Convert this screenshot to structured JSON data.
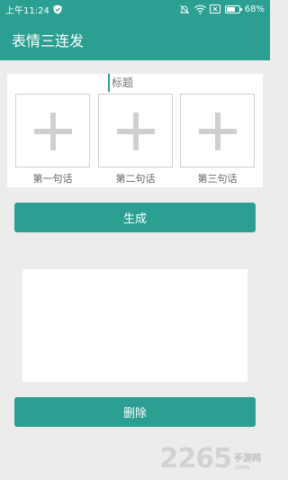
{
  "status_bar": {
    "time": "上午11:24",
    "battery_text": "68%",
    "battery_level": 0.68,
    "icons": [
      "shield-icon",
      "mute-bell-icon",
      "wifi-icon",
      "sim-x-icon",
      "battery-icon"
    ]
  },
  "app_bar": {
    "title": "表情三连发"
  },
  "form": {
    "title_placeholder": "标题",
    "slots": [
      {
        "label": "第一句话",
        "icon": "plus-icon"
      },
      {
        "label": "第二句话",
        "icon": "plus-icon"
      },
      {
        "label": "第三句话",
        "icon": "plus-icon"
      }
    ]
  },
  "buttons": {
    "generate": "生成",
    "delete": "删除"
  },
  "watermark": {
    "number": "2265",
    "chinese": "手游网",
    "domain": ".com"
  },
  "colors": {
    "accent": "#2a9f92",
    "background": "#ececec",
    "plus": "#cfcfcf"
  }
}
